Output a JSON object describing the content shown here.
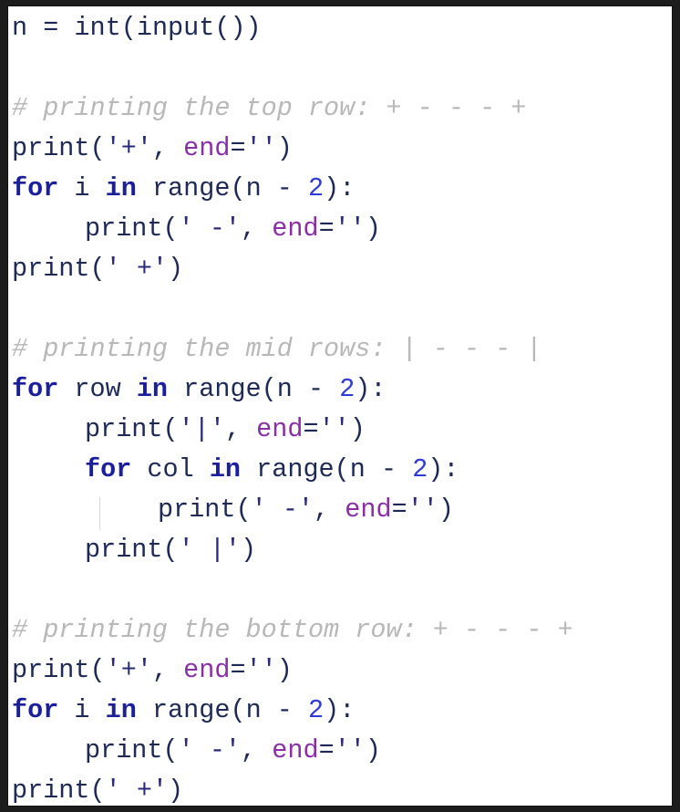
{
  "code_lines": [
    {
      "indent": 0,
      "tokens": [
        [
          "plain",
          "n = "
        ],
        [
          "plain",
          "int"
        ],
        [
          "plain",
          "(input())"
        ]
      ]
    },
    {
      "indent": 0,
      "tokens": []
    },
    {
      "indent": 0,
      "tokens": [
        [
          "cmt",
          "# printing the top row: + - - - +"
        ]
      ]
    },
    {
      "indent": 0,
      "tokens": [
        [
          "plain",
          "print("
        ],
        [
          "str",
          "'+'"
        ],
        [
          "plain",
          ", "
        ],
        [
          "kwarg",
          "end"
        ],
        [
          "plain",
          "="
        ],
        [
          "str",
          "''"
        ],
        [
          "plain",
          ")"
        ]
      ]
    },
    {
      "indent": 0,
      "tokens": [
        [
          "kw",
          "for"
        ],
        [
          "plain",
          " i "
        ],
        [
          "kw",
          "in"
        ],
        [
          "plain",
          " range(n - "
        ],
        [
          "num",
          "2"
        ],
        [
          "plain",
          "):"
        ]
      ]
    },
    {
      "indent": 1,
      "tokens": [
        [
          "plain",
          "print("
        ],
        [
          "str",
          "' -'"
        ],
        [
          "plain",
          ", "
        ],
        [
          "kwarg",
          "end"
        ],
        [
          "plain",
          "="
        ],
        [
          "str",
          "''"
        ],
        [
          "plain",
          ")"
        ]
      ]
    },
    {
      "indent": 0,
      "tokens": [
        [
          "plain",
          "print("
        ],
        [
          "str",
          "' +'"
        ],
        [
          "plain",
          ")"
        ]
      ]
    },
    {
      "indent": 0,
      "tokens": []
    },
    {
      "indent": 0,
      "tokens": [
        [
          "cmt",
          "# printing the mid rows: | - - - |"
        ]
      ]
    },
    {
      "indent": 0,
      "tokens": [
        [
          "kw",
          "for"
        ],
        [
          "plain",
          " row "
        ],
        [
          "kw",
          "in"
        ],
        [
          "plain",
          " range(n - "
        ],
        [
          "num",
          "2"
        ],
        [
          "plain",
          "):"
        ]
      ]
    },
    {
      "indent": 1,
      "tokens": [
        [
          "plain",
          "print("
        ],
        [
          "str",
          "'|'"
        ],
        [
          "plain",
          ", "
        ],
        [
          "kwarg",
          "end"
        ],
        [
          "plain",
          "="
        ],
        [
          "str",
          "''"
        ],
        [
          "plain",
          ")"
        ]
      ]
    },
    {
      "indent": 1,
      "tokens": [
        [
          "kw",
          "for"
        ],
        [
          "plain",
          " col "
        ],
        [
          "kw",
          "in"
        ],
        [
          "plain",
          " range(n - "
        ],
        [
          "num",
          "2"
        ],
        [
          "plain",
          "):"
        ]
      ]
    },
    {
      "indent": 2,
      "tokens": [
        [
          "plain",
          "print("
        ],
        [
          "str",
          "' -'"
        ],
        [
          "plain",
          ", "
        ],
        [
          "kwarg",
          "end"
        ],
        [
          "plain",
          "="
        ],
        [
          "str",
          "''"
        ],
        [
          "plain",
          ")"
        ]
      ]
    },
    {
      "indent": 1,
      "tokens": [
        [
          "plain",
          "print("
        ],
        [
          "str",
          "' |'"
        ],
        [
          "plain",
          ")"
        ]
      ]
    },
    {
      "indent": 0,
      "tokens": []
    },
    {
      "indent": 0,
      "tokens": [
        [
          "cmt",
          "# printing the bottom row: + - - - +"
        ]
      ]
    },
    {
      "indent": 0,
      "tokens": [
        [
          "plain",
          "print("
        ],
        [
          "str",
          "'+'"
        ],
        [
          "plain",
          ", "
        ],
        [
          "kwarg",
          "end"
        ],
        [
          "plain",
          "="
        ],
        [
          "str",
          "''"
        ],
        [
          "plain",
          ")"
        ]
      ]
    },
    {
      "indent": 0,
      "tokens": [
        [
          "kw",
          "for"
        ],
        [
          "plain",
          " i "
        ],
        [
          "kw",
          "in"
        ],
        [
          "plain",
          " range(n - "
        ],
        [
          "num",
          "2"
        ],
        [
          "plain",
          "):"
        ]
      ]
    },
    {
      "indent": 1,
      "tokens": [
        [
          "plain",
          "print("
        ],
        [
          "str",
          "' -'"
        ],
        [
          "plain",
          ", "
        ],
        [
          "kwarg",
          "end"
        ],
        [
          "plain",
          "="
        ],
        [
          "str",
          "''"
        ],
        [
          "plain",
          ")"
        ]
      ]
    },
    {
      "indent": 0,
      "tokens": [
        [
          "plain",
          "print("
        ],
        [
          "str",
          "' +'"
        ],
        [
          "plain",
          ")"
        ]
      ]
    }
  ],
  "colors": {
    "background": "#ffffff",
    "keyword": "#1a1f9e",
    "identifier": "#1e2a55",
    "number": "#2e3bd6",
    "string": "#2a2a7a",
    "kwarg": "#8a2fa8",
    "comment": "#b8b8b8"
  }
}
